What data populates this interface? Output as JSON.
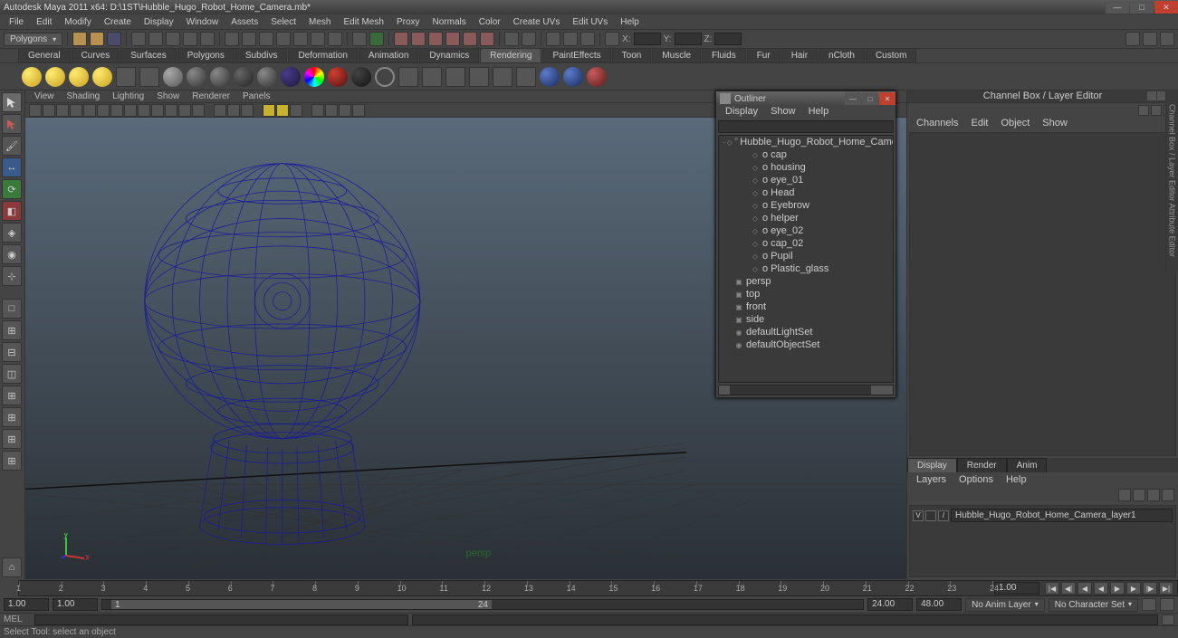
{
  "title": "Autodesk Maya 2011 x64: D:\\1ST\\Hubble_Hugo_Robot_Home_Camera.mb*",
  "menus": [
    "File",
    "Edit",
    "Modify",
    "Create",
    "Display",
    "Window",
    "Assets",
    "Select",
    "Mesh",
    "Edit Mesh",
    "Proxy",
    "Normals",
    "Color",
    "Create UVs",
    "Edit UVs",
    "Help"
  ],
  "mode_dropdown": "Polygons",
  "coord_labels": {
    "x": "X:",
    "y": "Y:",
    "z": "Z:"
  },
  "coord_vals": {
    "x": "",
    "y": "",
    "z": ""
  },
  "shelf_tabs": [
    "General",
    "Curves",
    "Surfaces",
    "Polygons",
    "Subdivs",
    "Deformation",
    "Animation",
    "Dynamics",
    "Rendering",
    "PaintEffects",
    "Toon",
    "Muscle",
    "Fluids",
    "Fur",
    "Hair",
    "nCloth",
    "Custom"
  ],
  "shelf_active": "Rendering",
  "vp_menus": [
    "View",
    "Shading",
    "Lighting",
    "Show",
    "Renderer",
    "Panels"
  ],
  "outliner": {
    "title": "Outliner",
    "menus": [
      "Display",
      "Show",
      "Help"
    ],
    "items": [
      {
        "indent": 0,
        "exp": "-",
        "icon": "◇",
        "label": "Hubble_Hugo_Robot_Home_Camera",
        "dim": false,
        "pin": true
      },
      {
        "indent": 1,
        "exp": "",
        "icon": "◇",
        "label": "o cap",
        "dim": false
      },
      {
        "indent": 1,
        "exp": "",
        "icon": "◇",
        "label": "o housing",
        "dim": false
      },
      {
        "indent": 1,
        "exp": "",
        "icon": "◇",
        "label": "o eye_01",
        "dim": false
      },
      {
        "indent": 1,
        "exp": "",
        "icon": "◇",
        "label": "o Head",
        "dim": false
      },
      {
        "indent": 1,
        "exp": "",
        "icon": "◇",
        "label": "o Eyebrow",
        "dim": false
      },
      {
        "indent": 1,
        "exp": "",
        "icon": "◇",
        "label": "o helper",
        "dim": false
      },
      {
        "indent": 1,
        "exp": "",
        "icon": "◇",
        "label": "o eye_02",
        "dim": false
      },
      {
        "indent": 1,
        "exp": "",
        "icon": "◇",
        "label": "o cap_02",
        "dim": false
      },
      {
        "indent": 1,
        "exp": "",
        "icon": "◇",
        "label": "o Pupil",
        "dim": false
      },
      {
        "indent": 1,
        "exp": "",
        "icon": "◇",
        "label": "o Plastic_glass",
        "dim": false
      },
      {
        "indent": 0,
        "exp": "",
        "icon": "▣",
        "label": "persp",
        "dim": true
      },
      {
        "indent": 0,
        "exp": "",
        "icon": "▣",
        "label": "top",
        "dim": true
      },
      {
        "indent": 0,
        "exp": "",
        "icon": "▣",
        "label": "front",
        "dim": true
      },
      {
        "indent": 0,
        "exp": "",
        "icon": "▣",
        "label": "side",
        "dim": true
      },
      {
        "indent": 0,
        "exp": "",
        "icon": "◉",
        "label": "defaultLightSet",
        "dim": false
      },
      {
        "indent": 0,
        "exp": "",
        "icon": "◉",
        "label": "defaultObjectSet",
        "dim": false
      }
    ]
  },
  "channelbox": {
    "title": "Channel Box / Layer Editor",
    "menus": [
      "Channels",
      "Edit",
      "Object",
      "Show"
    ],
    "layer_tabs": [
      "Display",
      "Render",
      "Anim"
    ],
    "layer_tab_active": "Display",
    "layer_menus": [
      "Layers",
      "Options",
      "Help"
    ],
    "layer_rows": [
      {
        "v": "V",
        "slash": "/",
        "name": "Hubble_Hugo_Robot_Home_Camera_layer1"
      }
    ]
  },
  "timeline": {
    "current": "1.00",
    "start": "1.00",
    "range_start": "1.00",
    "range_bar_start": "1",
    "range_bar_end": "24",
    "range_end": "24.00",
    "end": "48.00",
    "anim_layer": "No Anim Layer",
    "char_set": "No Character Set",
    "ticks": [
      1,
      2,
      3,
      4,
      5,
      6,
      7,
      8,
      9,
      10,
      11,
      12,
      13,
      14,
      15,
      16,
      17,
      18,
      19,
      20,
      21,
      22,
      23,
      24
    ]
  },
  "cmdline_label": "MEL",
  "helpline": "Select Tool: select an object",
  "rtab": "Channel Box / Layer Editor  Attribute Editor"
}
